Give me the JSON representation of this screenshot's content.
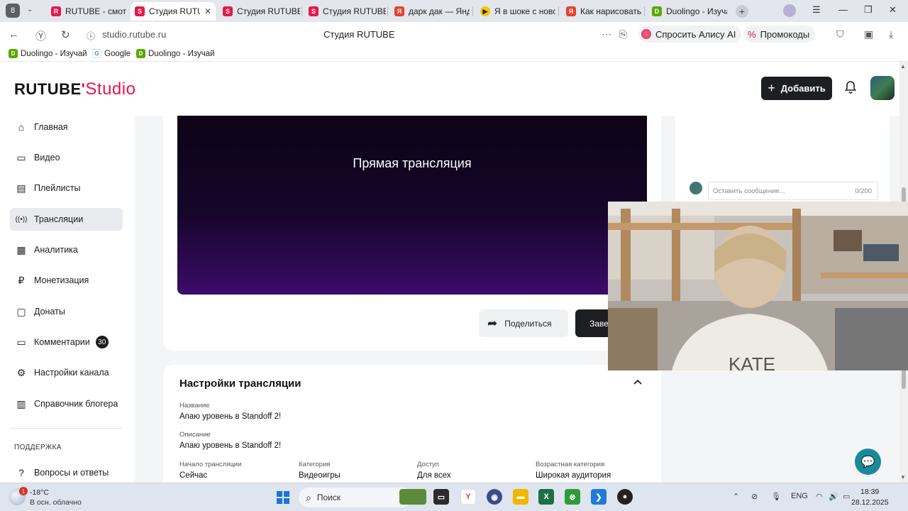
{
  "browser": {
    "tab_count": "8",
    "tabs": [
      {
        "label": "RUTUBE - смотр",
        "fav_color": "#e8174b",
        "fav_letter": "R"
      },
      {
        "label": "Студия RUTUBE",
        "fav_color": "#e8174b",
        "fav_letter": "S"
      },
      {
        "label": "Студия RUTUBE",
        "fav_color": "#e8174b",
        "fav_letter": "S"
      },
      {
        "label": "Студия RUTUBE",
        "fav_color": "#e8174b",
        "fav_letter": "S"
      },
      {
        "label": "дарк дак — Янд",
        "fav_color": "#ea3f2e",
        "fav_letter": "Я"
      },
      {
        "label": "Я в шоке с новой",
        "fav_color": "#f6c500",
        "fav_letter": "▶"
      },
      {
        "label": "Как нарисовать",
        "fav_color": "#ea3f2e",
        "fav_letter": "Я"
      },
      {
        "label": "Duolingo - Изуча",
        "fav_color": "#58a700",
        "fav_letter": "D"
      }
    ],
    "url": "studio.rutube.ru",
    "page_title": "Студия RUTUBE",
    "alice_label": "Спросить Алису AI",
    "promo_label": "Промокоды",
    "bookmarks": [
      {
        "label": "Duolingo - Изучай",
        "fav_color": "#58a700",
        "fav_letter": "D"
      },
      {
        "label": "Google",
        "fav_color": "#4285f4",
        "fav_letter": "G"
      },
      {
        "label": "Duolingo - Изучай",
        "fav_color": "#58a700",
        "fav_letter": "D"
      }
    ]
  },
  "header": {
    "logo_main": "RUTUBE",
    "logo_dot": "'",
    "logo_studio": "Studio",
    "add_label": "Добавить"
  },
  "sidebar": {
    "items": [
      {
        "label": "Главная",
        "icon": "house-icon",
        "glyph": "⌂"
      },
      {
        "label": "Видео",
        "icon": "video-icon",
        "glyph": "▭"
      },
      {
        "label": "Плейлисты",
        "icon": "playlist-icon",
        "glyph": "▤"
      },
      {
        "label": "Трансляции",
        "icon": "broadcast-icon",
        "glyph": "((•))"
      },
      {
        "label": "Аналитика",
        "icon": "analytics-icon",
        "glyph": "▦"
      },
      {
        "label": "Монетизация",
        "icon": "ruble-icon",
        "glyph": "₽"
      },
      {
        "label": "Донаты",
        "icon": "donate-icon",
        "glyph": "▢"
      },
      {
        "label": "Комментарии",
        "icon": "comment-icon",
        "glyph": "▭",
        "badge": "30"
      },
      {
        "label": "Настройки канала",
        "icon": "gear-icon",
        "glyph": "⚙"
      },
      {
        "label": "Справочник блогера",
        "icon": "book-icon",
        "glyph": "▥"
      }
    ],
    "support_heading": "ПОДДЕРЖКА",
    "faq_label": "Вопросы и ответы"
  },
  "broadcast": {
    "video_title": "Прямая трансляция",
    "share_label": "Поделиться",
    "finish_label": "Заве"
  },
  "chat": {
    "placeholder": "Оставить сообщение...",
    "counter": "0/200"
  },
  "settings": {
    "title": "Настройки трансляции",
    "name_label": "Название",
    "name_value": "Апаю уровень в Standoff 2!",
    "desc_label": "Описание",
    "desc_value": "Апаю уровень в Standoff 2!",
    "start_label": "Начало трансляции",
    "start_value": "Сейчас",
    "category_label": "Категория",
    "category_value": "Видеоигры",
    "access_label": "Доступ",
    "access_value": "Для всех",
    "age_label": "Возрастная категория",
    "age_value": "Широкая аудитория"
  },
  "taskbar": {
    "weather_badge": "1",
    "weather_temp": "-18°C",
    "weather_desc": "В осн. облачно",
    "search_label": "Поиск",
    "lang": "ENG",
    "time": "18:39",
    "date": "28.12.2025"
  }
}
